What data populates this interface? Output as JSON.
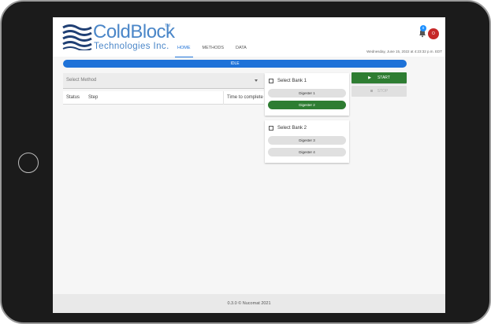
{
  "brand": {
    "name": "ColdBlock",
    "tm": "TM",
    "subtitle": "Technologies Inc.",
    "color": "#4a86c8"
  },
  "nav": {
    "tabs": [
      {
        "label": "HOME",
        "active": true
      },
      {
        "label": "METHODS",
        "active": false
      },
      {
        "label": "DATA",
        "active": false
      }
    ]
  },
  "header": {
    "notification_count": "0",
    "avatar_initial": "O",
    "datetime": "Wednesday, June 15, 2022 at 4:23:32 p.m. EDT"
  },
  "status": {
    "text": "IDLE",
    "color": "#1e72d8"
  },
  "method": {
    "placeholder": "Select Method",
    "columns": {
      "status": "Status",
      "step": "Step",
      "time": "Time to complete"
    }
  },
  "banks": [
    {
      "label": "Select Bank 1",
      "checked": false,
      "digesters": [
        {
          "label": "Digester 1",
          "active": false
        },
        {
          "label": "Digester 2",
          "active": true
        }
      ]
    },
    {
      "label": "Select Bank 2",
      "checked": false,
      "digesters": [
        {
          "label": "Digester 3",
          "active": false
        },
        {
          "label": "Digester 4",
          "active": false
        }
      ]
    }
  ],
  "controls": {
    "start_label": "START",
    "stop_label": "STOP",
    "start_color": "#2e7d32"
  },
  "footer": {
    "text": "0.3.0 © Nucomat 2021"
  },
  "icons": {
    "play": "play-icon",
    "stop": "stop-icon",
    "bell": "bell-icon",
    "dropdown": "chevron-down-icon"
  }
}
